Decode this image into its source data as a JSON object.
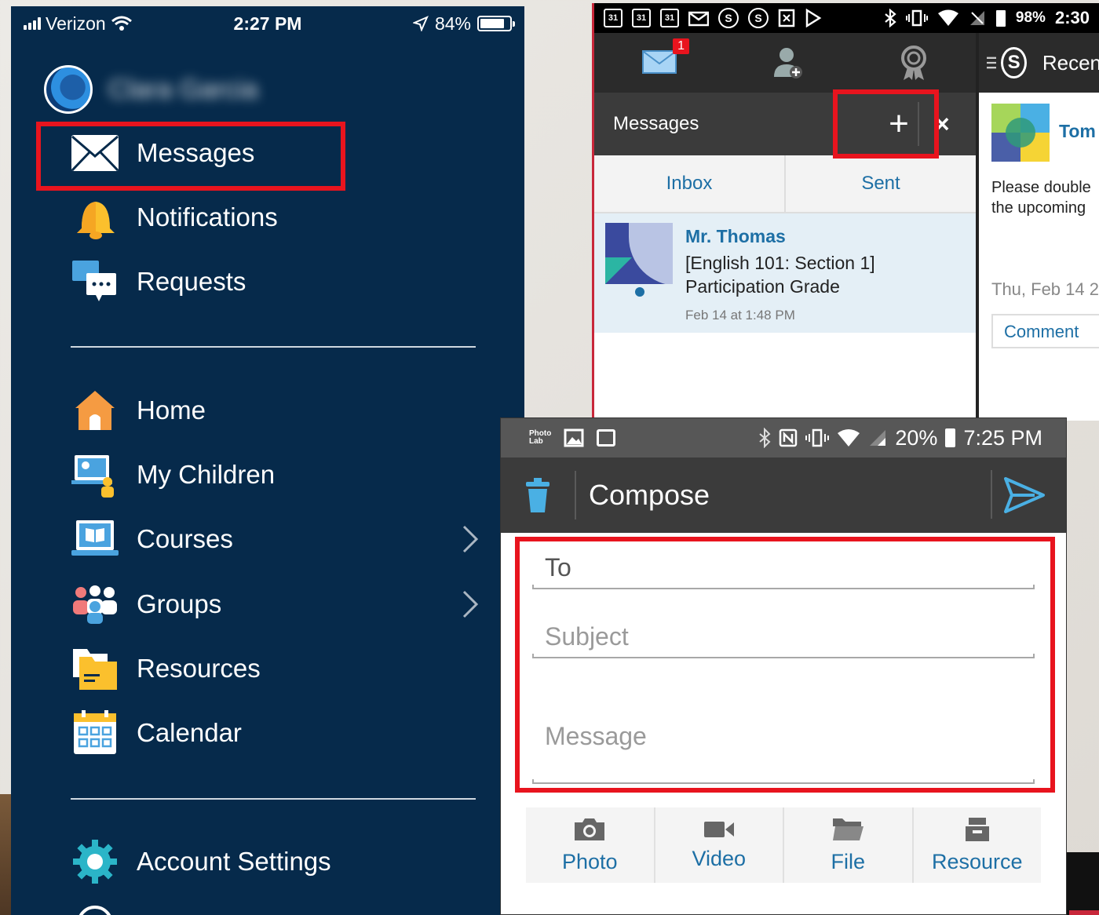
{
  "ios": {
    "status": {
      "carrier": "Verizon",
      "time": "2:27 PM",
      "battery": "84%",
      "battery_level": 0.84
    },
    "user_name": "Clara Garcia",
    "menu": {
      "messages": "Messages",
      "notifications": "Notifications",
      "requests": "Requests",
      "home": "Home",
      "my_children": "My Children",
      "courses": "Courses",
      "groups": "Groups",
      "resources": "Resources",
      "calendar": "Calendar",
      "account_settings": "Account Settings"
    }
  },
  "android": {
    "status": {
      "cal1": "31",
      "cal2": "31",
      "cal3": "31",
      "s1": "S",
      "s2": "S",
      "battery": "98%",
      "time": "2:30"
    },
    "nav_badge": "1",
    "messages_title": "Messages",
    "add_label": "+",
    "close_label": "×",
    "tabs": {
      "inbox": "Inbox",
      "sent": "Sent"
    },
    "message": {
      "sender": "Mr. Thomas",
      "subject_line1": "[English 101: Section 1]",
      "subject_line2": "Participation Grade",
      "date": "Feb 14 at 1:48 PM"
    },
    "right_panel": {
      "logo_letter": "S",
      "title": "Recen",
      "name": "Tom",
      "text_line1": "Please double",
      "text_line2": "the upcoming",
      "date": "Thu, Feb 14 2",
      "comment": "Comment"
    }
  },
  "compose": {
    "status": {
      "app": "Photo Lab",
      "battery": "20%",
      "time": "7:25 PM"
    },
    "title": "Compose",
    "to_label": "To",
    "subject_placeholder": "Subject",
    "message_placeholder": "Message",
    "tools": {
      "photo": "Photo",
      "video": "Video",
      "file": "File",
      "resource": "Resource"
    }
  },
  "colors": {
    "highlight": "#e8141e",
    "ios_bg": "#062a4b",
    "link_blue": "#1d6fa5",
    "bar_dark": "#3b3b3b"
  }
}
